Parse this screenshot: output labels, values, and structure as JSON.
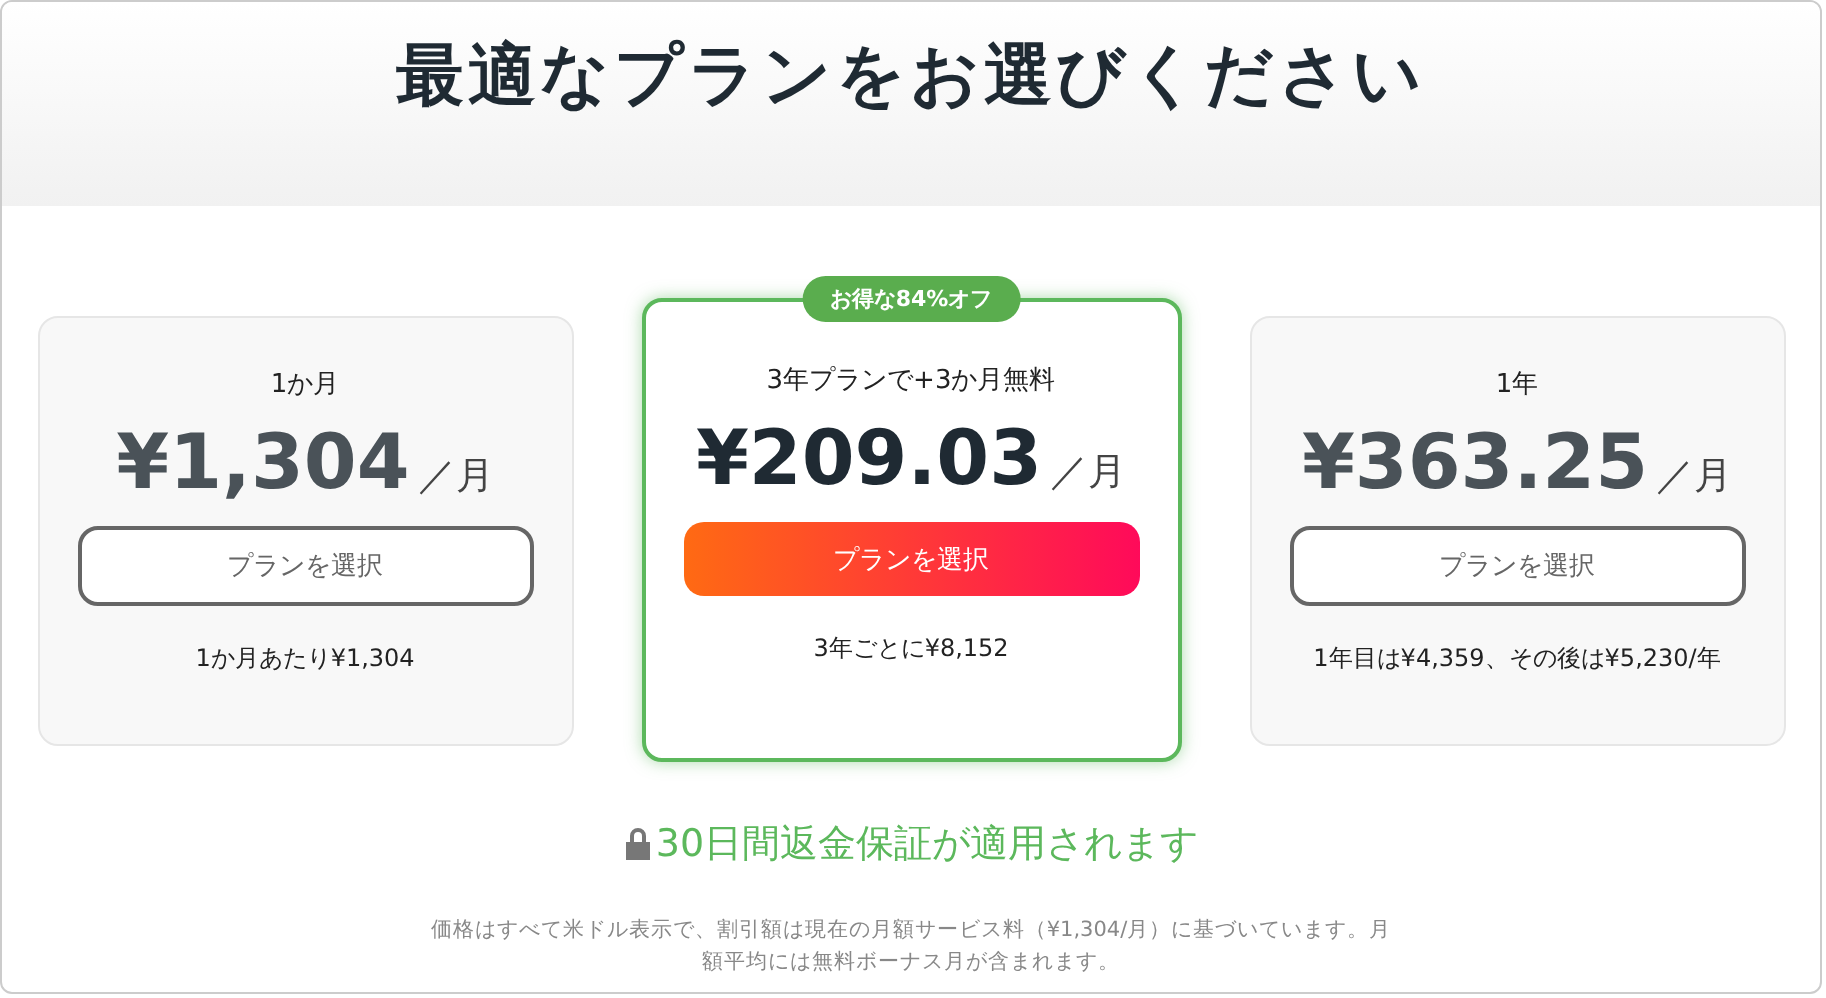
{
  "title": "最適なプランをお選びください",
  "plans": [
    {
      "name": "1か月",
      "featured": false,
      "price": "¥1,304",
      "unit": "／月",
      "button": "プランを選択",
      "note": "1か月あたり¥1,304"
    },
    {
      "name": "3年プランで+3か月無料",
      "badge": "お得な84%オフ",
      "featured": true,
      "price": "¥209.03",
      "unit": "／月",
      "button": "プランを選択",
      "note": "3年ごとに¥8,152"
    },
    {
      "name": "1年",
      "featured": false,
      "price": "¥363.25",
      "unit": "／月",
      "button": "プランを選択",
      "note": "1年目は¥4,359、その後は¥5,230/年"
    }
  ],
  "guarantee": "30日間返金保証が適用されます",
  "footnote": "価格はすべて米ドル表示で、割引額は現在の月額サービス料（¥1,304/月）に基づいています。月額平均には無料ボーナス月が含まれます。"
}
